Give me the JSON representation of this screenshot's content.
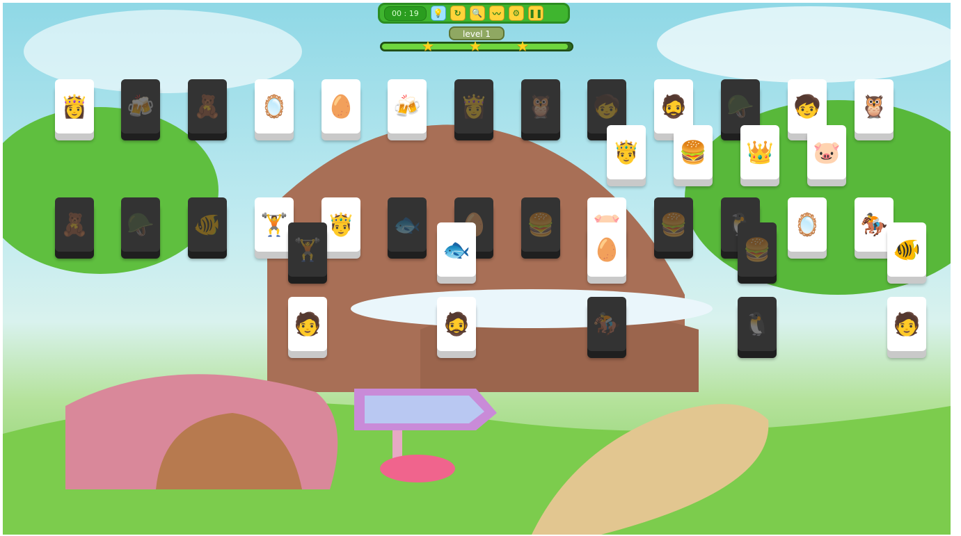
{
  "hud": {
    "timer": "00 : 19",
    "buttons": [
      {
        "name": "hint-button",
        "icon": "lightbulb-icon",
        "glyph": "💡"
      },
      {
        "name": "restart-button",
        "icon": "restart-icon",
        "glyph": "↻"
      },
      {
        "name": "zoom-button",
        "icon": "magnifier-icon",
        "glyph": "🔍"
      },
      {
        "name": "shuffle-button",
        "icon": "wave-icon",
        "glyph": "〰"
      },
      {
        "name": "settings-button",
        "icon": "gear-icon",
        "glyph": "⚙"
      },
      {
        "name": "pause-button",
        "icon": "pause-icon",
        "glyph": "❚❚"
      }
    ],
    "level_label": "level 1",
    "progress_fraction": 0.98,
    "stars": 3
  },
  "colors": {
    "hud_green": "#3fb52f",
    "star": "#ffd21e",
    "tile_face": "#ffffff",
    "tile_disabled": "#333333"
  },
  "tiles": [
    {
      "row": 1,
      "icon": "princess-icon",
      "glyph": "👸",
      "state": "free"
    },
    {
      "row": 1,
      "icon": "beer-mugs-icon",
      "glyph": "🍻",
      "state": "blocked"
    },
    {
      "row": 1,
      "icon": "bear-icon",
      "glyph": "🧸",
      "state": "blocked"
    },
    {
      "row": 1,
      "icon": "mirror-icon",
      "glyph": "🪞",
      "state": "free"
    },
    {
      "row": 1,
      "icon": "robot-egg-icon",
      "glyph": "🥚",
      "state": "free"
    },
    {
      "row": 1,
      "icon": "beer-mugs-icon",
      "glyph": "🍻",
      "state": "free"
    },
    {
      "row": 1,
      "icon": "princess-icon",
      "glyph": "👸",
      "state": "blocked"
    },
    {
      "row": 1,
      "icon": "owl-icon",
      "glyph": "🦉",
      "state": "blocked"
    },
    {
      "row": 1,
      "icon": "girl-egg-icon",
      "glyph": "🧒",
      "state": "blocked"
    },
    {
      "row": 1,
      "icon": "bearded-man-icon",
      "glyph": "🧔",
      "state": "free"
    },
    {
      "row": 1,
      "icon": "tank-icon",
      "glyph": "🪖",
      "state": "blocked"
    },
    {
      "row": 1,
      "icon": "girl-egg-icon",
      "glyph": "🧒",
      "state": "free"
    },
    {
      "row": 1,
      "icon": "owl-icon",
      "glyph": "🦉",
      "state": "free"
    },
    {
      "row": 2,
      "icon": "king-icon",
      "glyph": "🤴",
      "state": "free"
    },
    {
      "row": 2,
      "icon": "burger-icon",
      "glyph": "🍔",
      "state": "free"
    },
    {
      "row": 2,
      "icon": "crowned-head-icon",
      "glyph": "👑",
      "state": "free"
    },
    {
      "row": 2,
      "icon": "pig-icon",
      "glyph": "🐷",
      "state": "free"
    },
    {
      "row": 3,
      "icon": "bear-icon",
      "glyph": "🧸",
      "state": "blocked"
    },
    {
      "row": 3,
      "icon": "tank-icon",
      "glyph": "🪖",
      "state": "blocked"
    },
    {
      "row": 3,
      "icon": "fish-bowl-icon",
      "glyph": "🐠",
      "state": "blocked"
    },
    {
      "row": 3,
      "icon": "weightlifter-icon",
      "glyph": "🏋",
      "state": "free"
    },
    {
      "row": 3,
      "icon": "king-icon",
      "glyph": "🤴",
      "state": "free"
    },
    {
      "row": 3,
      "icon": "fish-icon",
      "glyph": "🐟",
      "state": "blocked"
    },
    {
      "row": 3,
      "icon": "robot-egg-icon",
      "glyph": "🥚",
      "state": "blocked"
    },
    {
      "row": 3,
      "icon": "burger-icon",
      "glyph": "🍔",
      "state": "blocked"
    },
    {
      "row": 3,
      "icon": "pig-icon",
      "glyph": "🐷",
      "state": "free"
    },
    {
      "row": 3,
      "icon": "burger-icon",
      "glyph": "🍔",
      "state": "blocked"
    },
    {
      "row": 3,
      "icon": "penguin-icon",
      "glyph": "🐧",
      "state": "blocked"
    },
    {
      "row": 3,
      "icon": "mirror-icon",
      "glyph": "🪞",
      "state": "free"
    },
    {
      "row": 3,
      "icon": "viking-horse-icon",
      "glyph": "🏇",
      "state": "free"
    },
    {
      "row": 4,
      "icon": "weightlifter-icon",
      "glyph": "🏋",
      "state": "blocked"
    },
    {
      "row": 4,
      "icon": "fish-icon",
      "glyph": "🐟",
      "state": "free"
    },
    {
      "row": 4,
      "icon": "robot-egg-icon",
      "glyph": "🥚",
      "state": "free"
    },
    {
      "row": 4,
      "icon": "burger-icon",
      "glyph": "🍔",
      "state": "blocked"
    },
    {
      "row": 4,
      "icon": "fish-bowl-icon",
      "glyph": "🐠",
      "state": "free"
    },
    {
      "row": 5,
      "icon": "boy-hero-icon",
      "glyph": "🧑",
      "state": "free"
    },
    {
      "row": 5,
      "icon": "bearded-man-icon",
      "glyph": "🧔",
      "state": "free"
    },
    {
      "row": 5,
      "icon": "viking-horse-icon",
      "glyph": "🏇",
      "state": "blocked"
    },
    {
      "row": 5,
      "icon": "penguin-icon",
      "glyph": "🐧",
      "state": "blocked"
    },
    {
      "row": 5,
      "icon": "boy-hero-icon",
      "glyph": "🧑",
      "state": "free"
    }
  ]
}
